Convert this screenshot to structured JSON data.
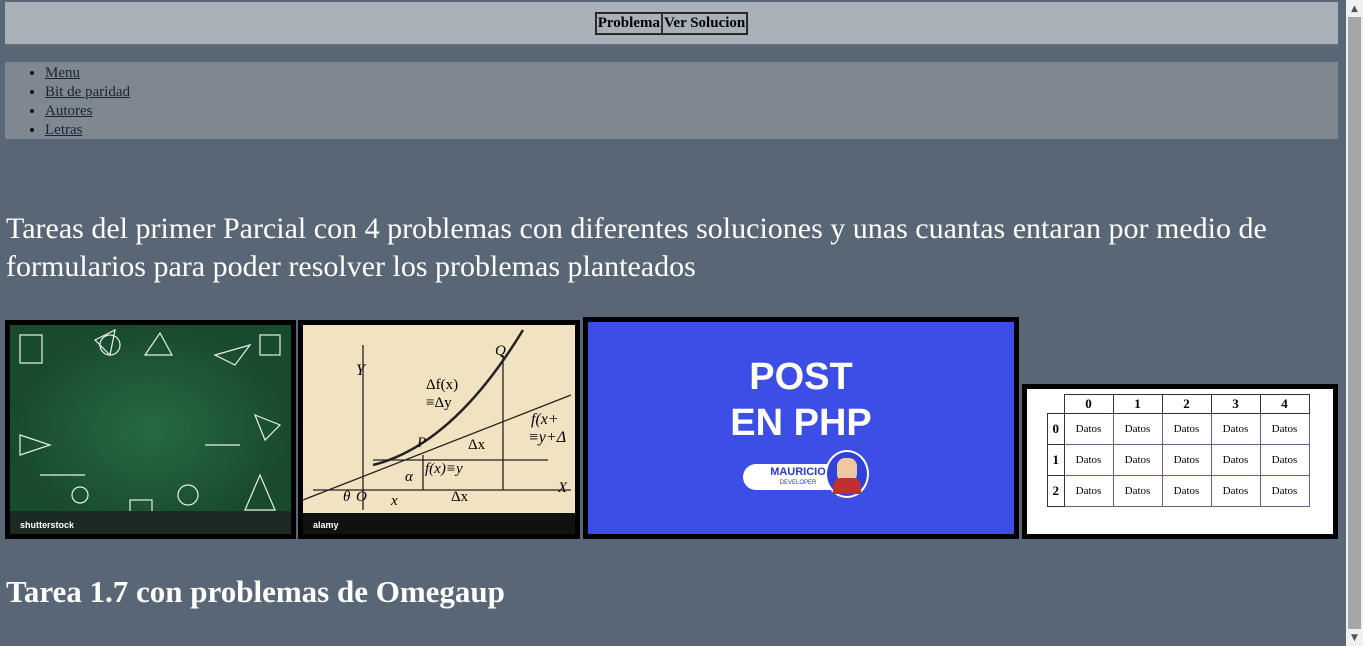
{
  "topbar": {
    "problem_button": "Problema",
    "solution_button": "Ver Solucion"
  },
  "nav": {
    "items": [
      "Menu",
      "Bit de paridad",
      "Autores",
      "Letras"
    ]
  },
  "intro": "Tareas del primer Parcial con 4 problemas con diferentes soluciones y unas cuantas entaran por medio de formularios para poder resolver los problemas planteados",
  "images": {
    "chalkboard": {
      "watermark": "shutterstock"
    },
    "math_graph": {
      "watermark": "alamy",
      "labels": [
        "Y",
        "Q",
        "Δf(x)",
        "≡Δy",
        "f(x+",
        "≡y+Δ",
        "P",
        "Δx",
        "α",
        "f(x)≡y",
        "θ",
        "O",
        "x",
        "Δx",
        "X"
      ]
    },
    "php": {
      "line1": "POST",
      "line2": "EN PHP",
      "badge_name": "MAURICIO",
      "badge_sub": "DEVELOPER"
    },
    "table": {
      "headers": [
        "0",
        "1",
        "2",
        "3",
        "4"
      ],
      "rows": [
        "0",
        "1",
        "2"
      ],
      "cell": "Datos"
    }
  },
  "section_heading": "Tarea 1.7 con problemas de Omegaup",
  "colors": {
    "page_bg": "#586676",
    "topbar_bg": "#a9b0b8",
    "nav_bg": "#7f8890",
    "php_blue": "#3d4ee6"
  }
}
